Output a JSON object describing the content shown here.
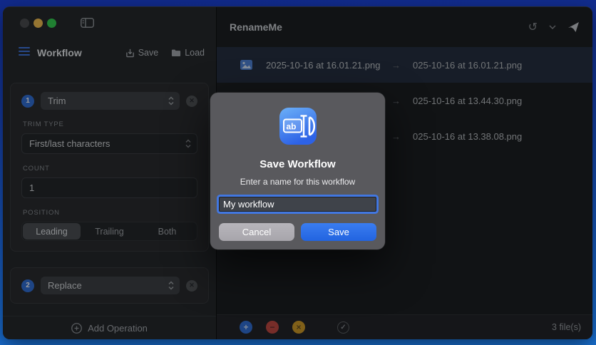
{
  "sidebar": {
    "title": "Workflow",
    "save_label": "Save",
    "load_label": "Load",
    "operations": [
      {
        "number": "1",
        "type": "Trim"
      },
      {
        "number": "2",
        "type": "Replace"
      }
    ],
    "fields": {
      "trim_type_label": "TRIM TYPE",
      "trim_type_value": "First/last characters",
      "count_label": "COUNT",
      "count_value": "1",
      "position_label": "POSITION",
      "position_options": [
        "Leading",
        "Trailing",
        "Both"
      ],
      "position_selected": "Leading"
    },
    "add_operation_label": "Add Operation"
  },
  "main": {
    "title": "RenameMe",
    "arrow": "→",
    "rows": [
      {
        "original": "2025-10-16 at 16.01.21.png",
        "renamed": "025-10-16 at 16.01.21.png",
        "selected": true
      },
      {
        "original": "",
        "renamed": "025-10-16 at 13.44.30.png",
        "selected": false
      },
      {
        "original": "",
        "renamed": "025-10-16 at 13.38.08.png",
        "selected": false
      }
    ],
    "status": "3 file(s)"
  },
  "dialog": {
    "title": "Save Workflow",
    "subtitle": "Enter a name for this workflow",
    "input_value": "My workflow",
    "cancel_label": "Cancel",
    "save_label": "Save",
    "app_icon_text": "ab"
  },
  "icons": {
    "history": "↺",
    "close": "✕",
    "plus": "+",
    "minus": "−",
    "cross": "×",
    "check": "✓"
  },
  "colors": {
    "accent_blue": "#2f6ed8",
    "save_button": "#2264e0",
    "cancel_button": "#aeacb2",
    "selected_row": "#232c3c",
    "desktop_top": "#112a8c",
    "desktop_bottom": "#1a74d8",
    "add_circle": "#2f6fd8",
    "remove_circle": "#c4473f",
    "clear_circle": "#d29b23"
  }
}
